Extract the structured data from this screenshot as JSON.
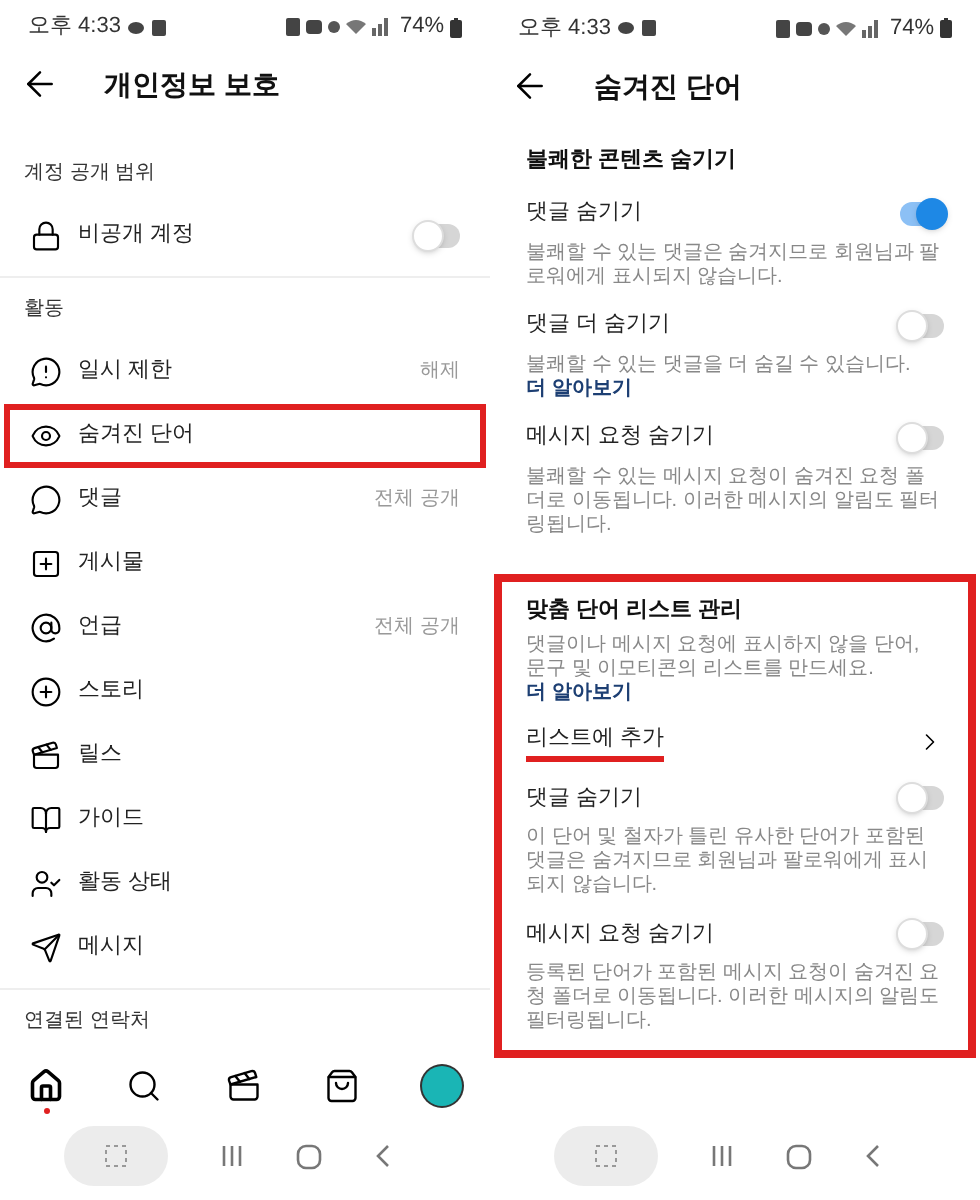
{
  "left_screen": {
    "status_bar": {
      "time": "오후 4:33",
      "battery": "74%"
    },
    "header": {
      "title": "개인정보 보호"
    },
    "sections": [
      {
        "title": "계정 공개 범위",
        "items": [
          {
            "kind": "toggle",
            "label": "비공개 계정",
            "on": false,
            "highlighted": false
          }
        ]
      },
      {
        "title": "활동",
        "items": [
          {
            "kind": "link",
            "label": "일시 제한",
            "value": "해제",
            "highlighted": false
          },
          {
            "kind": "link",
            "label": "숨겨진 단어",
            "highlighted": true
          },
          {
            "kind": "link",
            "label": "댓글",
            "value": "전체 공개",
            "highlighted": false
          },
          {
            "kind": "link",
            "label": "게시물",
            "highlighted": false
          },
          {
            "kind": "link",
            "label": "언급",
            "value": "전체 공개",
            "highlighted": false
          },
          {
            "kind": "link",
            "label": "스토리",
            "highlighted": false
          },
          {
            "kind": "link",
            "label": "릴스",
            "highlighted": false
          },
          {
            "kind": "link",
            "label": "가이드",
            "highlighted": false
          },
          {
            "kind": "link",
            "label": "활동 상태",
            "highlighted": false
          },
          {
            "kind": "link",
            "label": "메시지",
            "highlighted": false
          }
        ]
      },
      {
        "title": "연결된 연락처"
      }
    ],
    "bottom_nav": [
      {
        "selected": true,
        "badge": true
      },
      {
        "selected": false,
        "badge": false
      },
      {
        "selected": false,
        "badge": false
      },
      {
        "selected": false,
        "badge": false
      },
      {
        "selected": false,
        "badge": false
      }
    ]
  },
  "right_screen": {
    "status_bar": {
      "time": "오후 4:33",
      "battery": "74%"
    },
    "header": {
      "title": "숨겨진 단어"
    },
    "sections": [
      {
        "title": "불쾌한 콘텐츠 숨기기",
        "highlighted": false,
        "items": [
          {
            "kind": "toggle",
            "label": "댓글 숨기기",
            "on": true,
            "description": "불쾌할 수 있는 댓글은 숨겨지므로 회원님과 팔로워에게 표시되지 않습니다."
          },
          {
            "kind": "toggle",
            "label": "댓글 더 숨기기",
            "on": false,
            "description": "불쾌할 수 있는 댓글을 더 숨길 수 있습니다.",
            "link": "더 알아보기"
          },
          {
            "kind": "toggle",
            "label": "메시지 요청 숨기기",
            "on": false,
            "description": "불쾌할 수 있는 메시지 요청이 숨겨진 요청 폴더로 이동됩니다. 이러한 메시지의 알림도 필터링됩니다."
          }
        ]
      },
      {
        "title": "맞춤 단어 리스트 관리",
        "description": "댓글이나 메시지 요청에 표시하지 않을 단어, 문구 및 이모티콘의 리스트를 만드세요.",
        "link": "더 알아보기",
        "highlighted": true,
        "items": [
          {
            "kind": "link",
            "label": "리스트에 추가",
            "underlined": true
          },
          {
            "kind": "toggle",
            "label": "댓글 숨기기",
            "on": false,
            "description": "이 단어 및 철자가 틀린 유사한 단어가 포함된 댓글은 숨겨지므로 회원님과 팔로워에게 표시되지 않습니다."
          },
          {
            "kind": "toggle",
            "label": "메시지 요청 숨기기",
            "on": false,
            "description": "등록된 단어가 포함된 메시지 요청이 숨겨진 요청 폴더로 이동됩니다. 이러한 메시지의 알림도 필터링됩니다."
          }
        ]
      }
    ]
  }
}
